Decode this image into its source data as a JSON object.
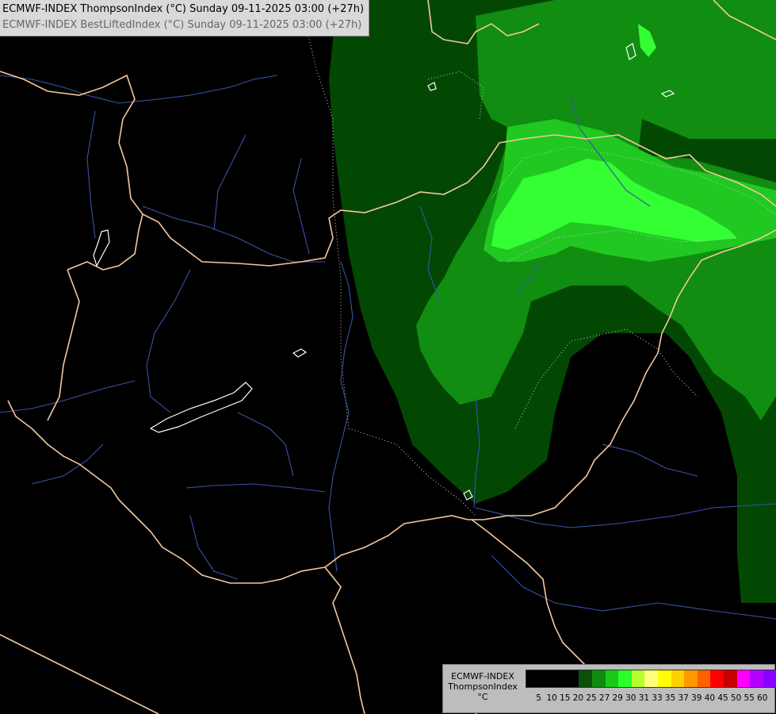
{
  "header": {
    "line1": "ECMWF-INDEX ThompsonIndex (°C) Sunday 09-11-2025 03:00 (+27h)",
    "line2": "ECMWF-INDEX BestLiftedIndex (°C) Sunday 09-11-2025 03:00 (+27h)"
  },
  "legend": {
    "title_line1": "ECMWF-INDEX",
    "title_line2": "ThompsonIndex",
    "unit": "°C",
    "ticks": [
      "5",
      "10",
      "15",
      "20",
      "25",
      "27",
      "29",
      "30",
      "31",
      "33",
      "35",
      "37",
      "39",
      "40",
      "45",
      "50",
      "55",
      "60"
    ],
    "colors": [
      "#000000",
      "#000000",
      "#000000",
      "#000000",
      "#0a4f0a",
      "#0f8a0f",
      "#19c819",
      "#2cff2c",
      "#b4ff2c",
      "#ffff7a",
      "#ffff00",
      "#ffd000",
      "#ff9900",
      "#ff6000",
      "#ff0000",
      "#c80000",
      "#ff00ff",
      "#b400ff",
      "#8c00ff",
      "#0000ff"
    ]
  },
  "map": {
    "colors": {
      "zone_20_25": "#024802",
      "zone_25_27": "#118d11",
      "zone_27_29": "#21c821",
      "zone_29_30": "#33ff33",
      "border": "#f5c79e",
      "river": "#3a53a8",
      "lake": "#ffffff",
      "contour": "#d0d0d0"
    }
  }
}
